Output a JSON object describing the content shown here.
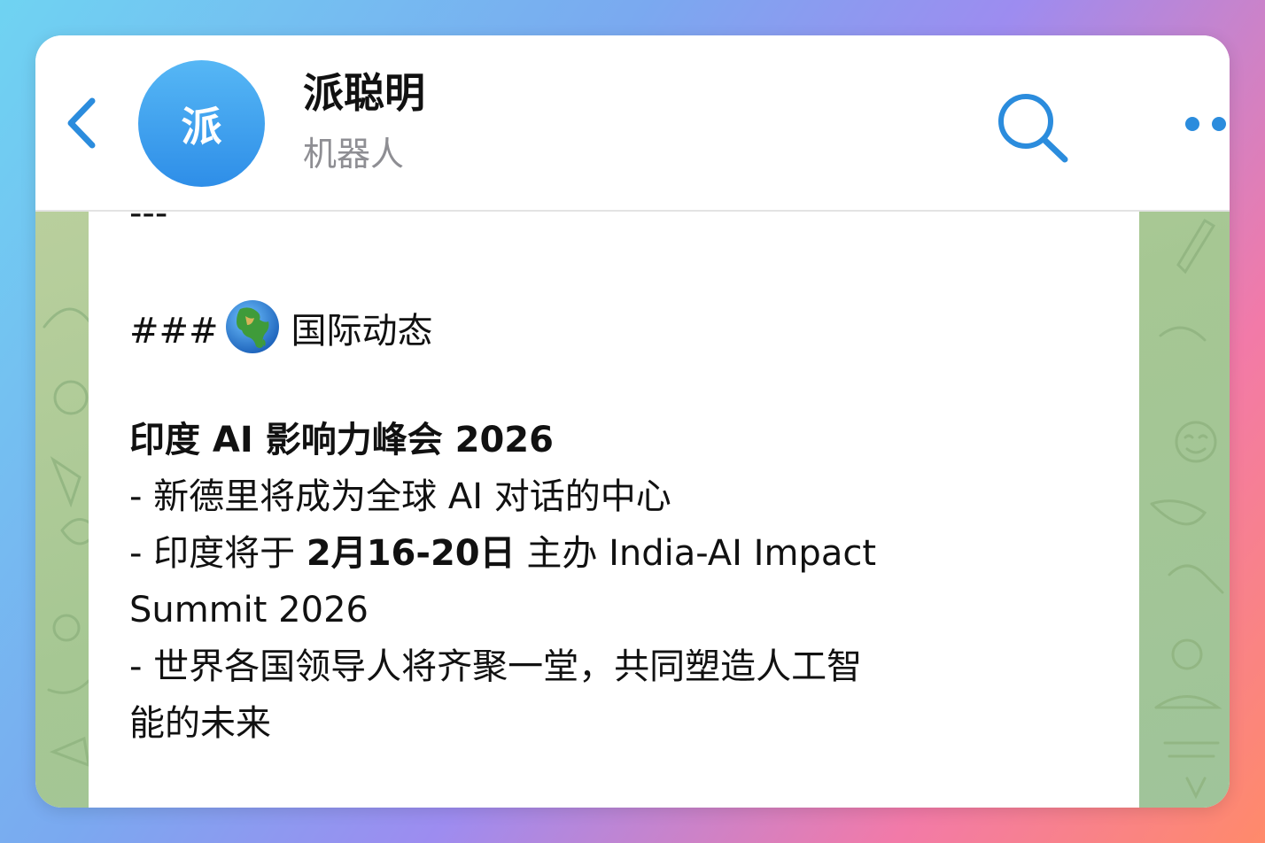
{
  "header": {
    "back_icon": "chevron-left-icon",
    "avatar_letter": "派",
    "chat_name": "派聪明",
    "chat_subtitle": "机器人",
    "search_icon": "search-icon",
    "more_icon": "more-dots-icon",
    "accent_color": "#2b8cdd"
  },
  "message": {
    "separator": "---",
    "section_hashes": "###",
    "section_icon": "globe-africa-icon",
    "section_title": "国际动态",
    "heading": "印度 AI 影响力峰会 2026",
    "bullet1": "- 新德里将成为全球 AI 对话的中心",
    "bullet2_prefix": "- 印度将于 ",
    "bullet2_date": "2月16-20日",
    "bullet2_suffix": " 主办 India-AI Impact",
    "bullet2_cont": "Summit 2026",
    "bullet3": "- 世界各国领导人将齐聚一堂，共同塑造人工智",
    "bullet3_cont": "能的未来"
  }
}
